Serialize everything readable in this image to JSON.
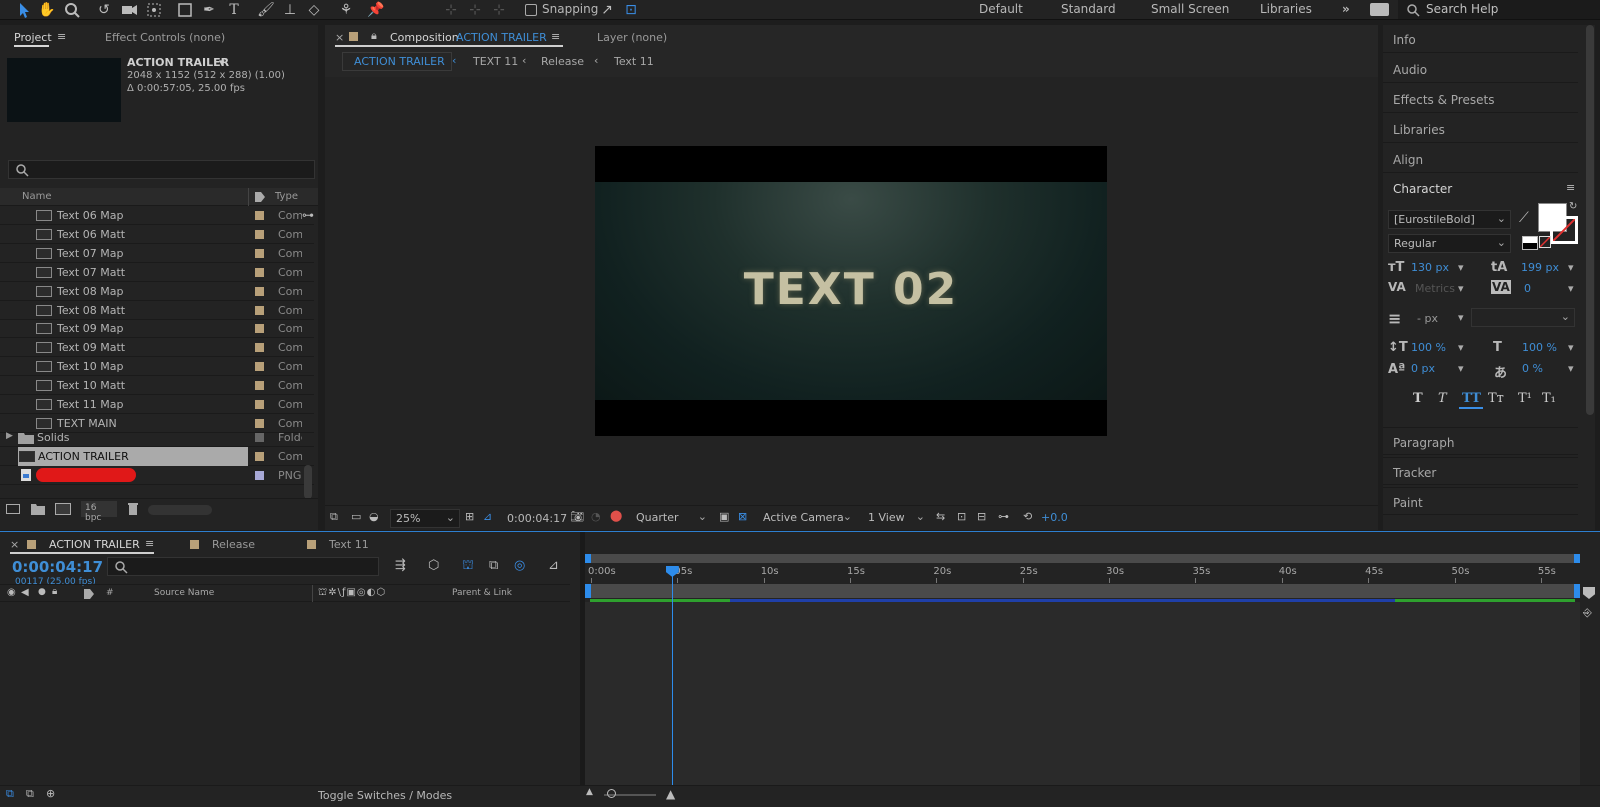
{
  "toolbar": {
    "snapping_label": "Snapping",
    "workspaces": [
      "Default",
      "Standard",
      "Small Screen",
      "Libraries"
    ],
    "search_placeholder": "Search Help"
  },
  "project_panel": {
    "tab_project": "Project",
    "tab_effect_controls": "Effect Controls (none)",
    "comp_name": "ACTION TRAILER",
    "comp_dims": "2048 x 1152  (512 x 288) (1.00)",
    "comp_duration": "Δ 0:00:57:05, 25.00 fps",
    "col_name": "Name",
    "col_type": "Type",
    "items": [
      {
        "name": "Text 06 Map",
        "type": "Comp"
      },
      {
        "name": "Text 06 Matt",
        "type": "Comp"
      },
      {
        "name": "Text 07 Map",
        "type": "Comp"
      },
      {
        "name": "Text 07 Matt",
        "type": "Comp"
      },
      {
        "name": "Text 08 Map",
        "type": "Comp"
      },
      {
        "name": "Text 08 Matt",
        "type": "Comp"
      },
      {
        "name": "Text 09 Map",
        "type": "Comp"
      },
      {
        "name": "Text 09 Matt",
        "type": "Comp"
      },
      {
        "name": "Text 10 Map",
        "type": "Comp"
      },
      {
        "name": "Text 10 Matt",
        "type": "Comp"
      },
      {
        "name": "Text 11 Map",
        "type": "Comp"
      },
      {
        "name": "TEXT MAIN",
        "type": "Comp"
      }
    ],
    "folder_solids": {
      "name": "Solids",
      "type": "Folder"
    },
    "selected_item": {
      "name": "ACTION TRAILER",
      "type": "Comp"
    },
    "png_item_type": "PNG",
    "bpc_label": "16 bpc"
  },
  "composition": {
    "tab_prefix": "Composition",
    "tab_name": "ACTION TRAILER",
    "tab_layer": "Layer (none)",
    "breadcrumbs": [
      "ACTION TRAILER",
      "TEXT 11",
      "Release",
      "Text 11"
    ],
    "viewer_text": "TEXT 02",
    "zoom": "25%",
    "timecode": "0:00:04:17",
    "resolution": "Quarter",
    "camera": "Active Camera",
    "views": "1 View",
    "exposure": "+0.0"
  },
  "right_panel": {
    "items_top": [
      "Info",
      "Audio",
      "Effects & Presets",
      "Libraries",
      "Align"
    ],
    "character_title": "Character",
    "font_family": "[EurostileBold]",
    "font_style": "Regular",
    "font_size": "130 px",
    "leading": "199 px",
    "kerning": "Metrics",
    "tracking": "0",
    "stroke_width": "- px",
    "vert_scale": "100 %",
    "horiz_scale": "100 %",
    "baseline_shift": "0 px",
    "tsume": "0 %",
    "style_buttons": [
      "T",
      "T",
      "TT",
      "Tᴛ",
      "T¹",
      "T₁"
    ],
    "items_bottom": [
      "Paragraph",
      "Tracker",
      "Paint"
    ]
  },
  "timeline": {
    "tabs": [
      "ACTION TRAILER",
      "Release",
      "Text 11"
    ],
    "timecode": "0:00:04:17",
    "frame_info": "00117 (25.00 fps)",
    "col_hash": "#",
    "col_source": "Source Name",
    "col_parent": "Parent & Link",
    "ruler": [
      "0:00s",
      "05s",
      "10s",
      "15s",
      "20s",
      "25s",
      "30s",
      "35s",
      "40s",
      "45s",
      "50s",
      "55s"
    ],
    "toggle_label": "Toggle Switches / Modes"
  },
  "colors": {
    "accent_blue": "#2d8ceb",
    "label_sand": "#b8a079",
    "bg_panel": "#232323",
    "work_green": "#2ea02e",
    "layer_blue": "#1f3fa8"
  },
  "playhead_seconds": 4.68,
  "comp_duration_seconds": 57.2
}
